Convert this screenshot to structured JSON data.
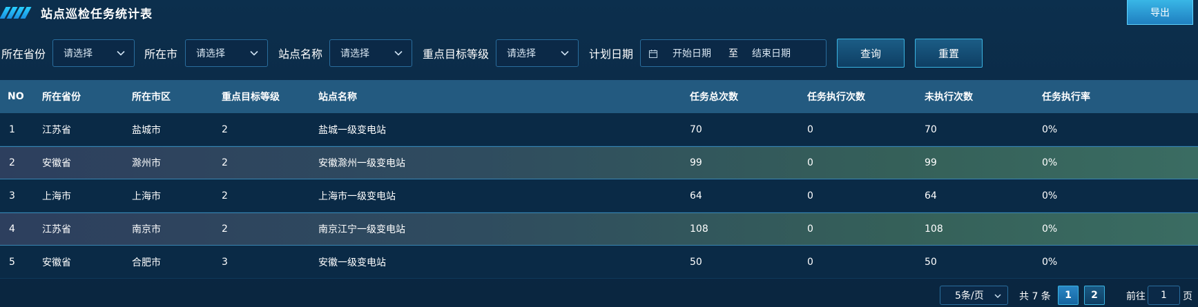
{
  "title": "站点巡检任务统计表",
  "export_label": "导出",
  "filters": {
    "province_label": "所在省份",
    "province_value": "请选择",
    "city_label": "所在市",
    "city_value": "请选择",
    "station_label": "站点名称",
    "station_value": "请选择",
    "level_label": "重点目标等级",
    "level_value": "请选择",
    "date_label": "计划日期",
    "date_start": "开始日期",
    "date_sep": "至",
    "date_end": "结束日期",
    "query_label": "查询",
    "reset_label": "重置"
  },
  "table": {
    "headers": [
      "NO",
      "所在省份",
      "所在市区",
      "重点目标等级",
      "站点名称",
      "任务总次数",
      "任务执行次数",
      "未执行次数",
      "任务执行率"
    ],
    "rows": [
      [
        "1",
        "江苏省",
        "盐城市",
        "2",
        "盐城一级变电站",
        "70",
        "0",
        "70",
        "0%"
      ],
      [
        "2",
        "安徽省",
        "滁州市",
        "2",
        "安徽滁州一级变电站",
        "99",
        "0",
        "99",
        "0%"
      ],
      [
        "3",
        "上海市",
        "上海市",
        "2",
        "上海市一级变电站",
        "64",
        "0",
        "64",
        "0%"
      ],
      [
        "4",
        "江苏省",
        "南京市",
        "2",
        "南京江宁一级变电站",
        "108",
        "0",
        "108",
        "0%"
      ],
      [
        "5",
        "安徽省",
        "合肥市",
        "3",
        "安徽一级变电站",
        "50",
        "0",
        "50",
        "0%"
      ]
    ]
  },
  "pagination": {
    "page_size": "5条/页",
    "total": "共 7 条",
    "pages": [
      "1",
      "2"
    ],
    "current_page": "1",
    "goto_label": "前往",
    "goto_value": "1",
    "page_suffix": "页"
  },
  "colors": {
    "background": "#0b2a45",
    "header_row": "#235a80",
    "accent": "#3bb5e3"
  },
  "icons": {
    "dropdown": "chevron-down-icon",
    "date": "calendar-icon",
    "title_decoration": "stripes-icon"
  }
}
